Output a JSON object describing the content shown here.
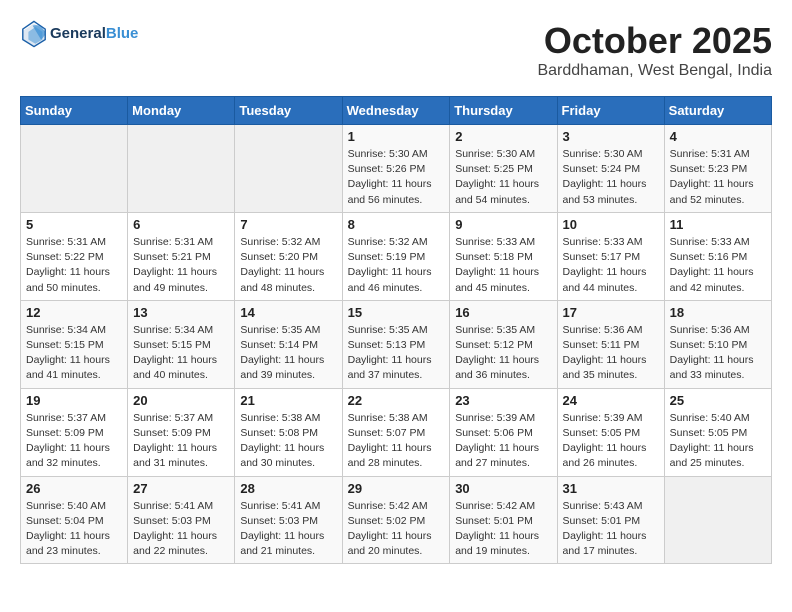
{
  "header": {
    "logo_line1": "General",
    "logo_line2": "Blue",
    "month": "October 2025",
    "location": "Barddhaman, West Bengal, India"
  },
  "weekdays": [
    "Sunday",
    "Monday",
    "Tuesday",
    "Wednesday",
    "Thursday",
    "Friday",
    "Saturday"
  ],
  "weeks": [
    [
      {
        "day": "",
        "info": ""
      },
      {
        "day": "",
        "info": ""
      },
      {
        "day": "",
        "info": ""
      },
      {
        "day": "1",
        "info": "Sunrise: 5:30 AM\nSunset: 5:26 PM\nDaylight: 11 hours\nand 56 minutes."
      },
      {
        "day": "2",
        "info": "Sunrise: 5:30 AM\nSunset: 5:25 PM\nDaylight: 11 hours\nand 54 minutes."
      },
      {
        "day": "3",
        "info": "Sunrise: 5:30 AM\nSunset: 5:24 PM\nDaylight: 11 hours\nand 53 minutes."
      },
      {
        "day": "4",
        "info": "Sunrise: 5:31 AM\nSunset: 5:23 PM\nDaylight: 11 hours\nand 52 minutes."
      }
    ],
    [
      {
        "day": "5",
        "info": "Sunrise: 5:31 AM\nSunset: 5:22 PM\nDaylight: 11 hours\nand 50 minutes."
      },
      {
        "day": "6",
        "info": "Sunrise: 5:31 AM\nSunset: 5:21 PM\nDaylight: 11 hours\nand 49 minutes."
      },
      {
        "day": "7",
        "info": "Sunrise: 5:32 AM\nSunset: 5:20 PM\nDaylight: 11 hours\nand 48 minutes."
      },
      {
        "day": "8",
        "info": "Sunrise: 5:32 AM\nSunset: 5:19 PM\nDaylight: 11 hours\nand 46 minutes."
      },
      {
        "day": "9",
        "info": "Sunrise: 5:33 AM\nSunset: 5:18 PM\nDaylight: 11 hours\nand 45 minutes."
      },
      {
        "day": "10",
        "info": "Sunrise: 5:33 AM\nSunset: 5:17 PM\nDaylight: 11 hours\nand 44 minutes."
      },
      {
        "day": "11",
        "info": "Sunrise: 5:33 AM\nSunset: 5:16 PM\nDaylight: 11 hours\nand 42 minutes."
      }
    ],
    [
      {
        "day": "12",
        "info": "Sunrise: 5:34 AM\nSunset: 5:15 PM\nDaylight: 11 hours\nand 41 minutes."
      },
      {
        "day": "13",
        "info": "Sunrise: 5:34 AM\nSunset: 5:15 PM\nDaylight: 11 hours\nand 40 minutes."
      },
      {
        "day": "14",
        "info": "Sunrise: 5:35 AM\nSunset: 5:14 PM\nDaylight: 11 hours\nand 39 minutes."
      },
      {
        "day": "15",
        "info": "Sunrise: 5:35 AM\nSunset: 5:13 PM\nDaylight: 11 hours\nand 37 minutes."
      },
      {
        "day": "16",
        "info": "Sunrise: 5:35 AM\nSunset: 5:12 PM\nDaylight: 11 hours\nand 36 minutes."
      },
      {
        "day": "17",
        "info": "Sunrise: 5:36 AM\nSunset: 5:11 PM\nDaylight: 11 hours\nand 35 minutes."
      },
      {
        "day": "18",
        "info": "Sunrise: 5:36 AM\nSunset: 5:10 PM\nDaylight: 11 hours\nand 33 minutes."
      }
    ],
    [
      {
        "day": "19",
        "info": "Sunrise: 5:37 AM\nSunset: 5:09 PM\nDaylight: 11 hours\nand 32 minutes."
      },
      {
        "day": "20",
        "info": "Sunrise: 5:37 AM\nSunset: 5:09 PM\nDaylight: 11 hours\nand 31 minutes."
      },
      {
        "day": "21",
        "info": "Sunrise: 5:38 AM\nSunset: 5:08 PM\nDaylight: 11 hours\nand 30 minutes."
      },
      {
        "day": "22",
        "info": "Sunrise: 5:38 AM\nSunset: 5:07 PM\nDaylight: 11 hours\nand 28 minutes."
      },
      {
        "day": "23",
        "info": "Sunrise: 5:39 AM\nSunset: 5:06 PM\nDaylight: 11 hours\nand 27 minutes."
      },
      {
        "day": "24",
        "info": "Sunrise: 5:39 AM\nSunset: 5:05 PM\nDaylight: 11 hours\nand 26 minutes."
      },
      {
        "day": "25",
        "info": "Sunrise: 5:40 AM\nSunset: 5:05 PM\nDaylight: 11 hours\nand 25 minutes."
      }
    ],
    [
      {
        "day": "26",
        "info": "Sunrise: 5:40 AM\nSunset: 5:04 PM\nDaylight: 11 hours\nand 23 minutes."
      },
      {
        "day": "27",
        "info": "Sunrise: 5:41 AM\nSunset: 5:03 PM\nDaylight: 11 hours\nand 22 minutes."
      },
      {
        "day": "28",
        "info": "Sunrise: 5:41 AM\nSunset: 5:03 PM\nDaylight: 11 hours\nand 21 minutes."
      },
      {
        "day": "29",
        "info": "Sunrise: 5:42 AM\nSunset: 5:02 PM\nDaylight: 11 hours\nand 20 minutes."
      },
      {
        "day": "30",
        "info": "Sunrise: 5:42 AM\nSunset: 5:01 PM\nDaylight: 11 hours\nand 19 minutes."
      },
      {
        "day": "31",
        "info": "Sunrise: 5:43 AM\nSunset: 5:01 PM\nDaylight: 11 hours\nand 17 minutes."
      },
      {
        "day": "",
        "info": ""
      }
    ]
  ]
}
